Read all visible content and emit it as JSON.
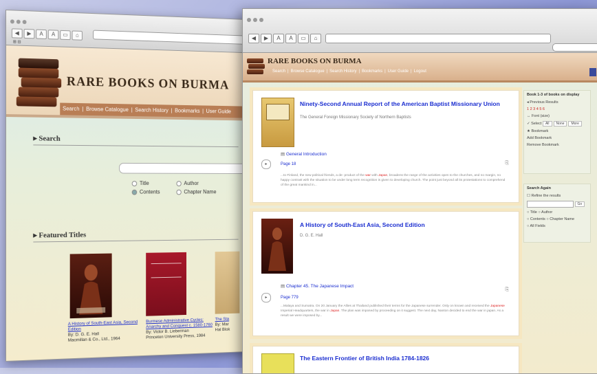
{
  "back": {
    "tabstrip": "⊞ ⊟",
    "banner_title": "RARE BOOKS ON BURMA",
    "nav": [
      "Search",
      "Browse Catalogue",
      "Search History",
      "Bookmarks",
      "User Guide"
    ],
    "search_heading": "Search",
    "options_row1": [
      "Title",
      "Author"
    ],
    "options_row2": [
      "Contents",
      "Chapter Name"
    ],
    "featured_heading": "Featured Titles",
    "books": [
      {
        "title": "A History of South-East Asia, Second Edition",
        "author": "By: D. G. E. Hall",
        "publisher": "Macmillan & Co., Ltd., 1964"
      },
      {
        "title": "Burmese Administrative Cycles: Anarchy and Conquest c. 1580-1760",
        "author": "By: Victor B. Lieberman",
        "publisher": "Princeton University Press, 1984"
      },
      {
        "title": "The Sta",
        "author": "By: Mar",
        "publisher": "Hal Blok"
      }
    ]
  },
  "front": {
    "banner_title": "RARE BOOKS ON BURMA",
    "nav": [
      "Search",
      "Browse Catalogue",
      "Search History",
      "Bookmarks",
      "User Guide",
      "Logout"
    ],
    "results": [
      {
        "title": "Ninety-Second Annual Report of the American Baptist Missionary Union",
        "sub": "The General Foreign Missionary Society of Northern Baptists",
        "chapter": "General Introduction",
        "page": "Page 18",
        "snippet_a": "...to Finland, the new political friends, a de- product of the ",
        "hl1": "war",
        "snippet_b": " with ",
        "hl2": "Japan",
        "snippet_c": ", broadens the range of the activities open to the churches, and no margin, no happy contrast with the situation to be under long term recognition is given to developing church. The point just beyond all its protestations to comprehend of the great mankind in..."
      },
      {
        "title": "A History of South-East Asia, Second Edition",
        "sub": "D. G. E. Hall",
        "chapter": "Chapter 45. The Japanese Impact",
        "page": "Page 779",
        "snippet_a": "...Malaya and Sumatra. On 20 January the Allies at Thailand published their terms for the Japanese surrender. Only on known and received the ",
        "hl1": "Japanese",
        "snippet_b": " Imperial Headquarters, the war in ",
        "hl2": "Japan",
        "snippet_c": ". The plan was imposed by proceeding on it suggest. The next day, Nanton decided to end the war in japan. As a result we were imposed by..."
      },
      {
        "title": "The Eastern Frontier of British India 1784-1826",
        "sub": "",
        "chapter": "",
        "page": "",
        "snippet_a": "",
        "hl1": "",
        "snippet_b": "",
        "hl2": "",
        "snippet_c": ""
      }
    ],
    "sidebar": {
      "count_label": "Book 1-3 of books on display",
      "prev_label": "Previous Results",
      "pager": "1 2 3 4 5 6",
      "textsize_label": "Font (size)",
      "select_label": "Select",
      "all": "All",
      "none": "None",
      "more": "More",
      "bookmarks_label": "Bookmark",
      "add_bm": "Add Bookmark",
      "remove_bm": "Remove Bookmark",
      "searchin_label": "Search Again",
      "refine_label": "Refine the results",
      "go": "Go",
      "options": [
        "Title",
        "Author",
        "Contents",
        "Chapter Name",
        "All Fields"
      ]
    }
  }
}
